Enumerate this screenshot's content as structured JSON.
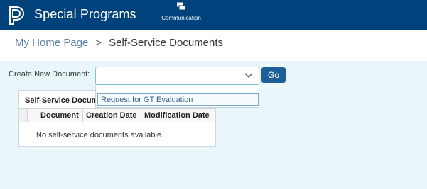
{
  "header": {
    "app_title": "Special Programs",
    "logo_icon": "powerschool-logo-icon",
    "communication": {
      "icon": "communication-icon",
      "label": "Communication"
    },
    "bar_color": "#00427c"
  },
  "breadcrumb": {
    "home": "My Home Page",
    "separator": ">",
    "current": "Self-Service Documents"
  },
  "create_document": {
    "label": "Create New Document:",
    "selected_value": "",
    "options": [
      "Request for GT Evaluation"
    ],
    "go_label": "Go"
  },
  "documents_panel": {
    "title": "Self-Service Documents",
    "columns": [
      "Document",
      "Creation Date",
      "Modification Date"
    ],
    "empty_message": "No self-service documents available."
  }
}
